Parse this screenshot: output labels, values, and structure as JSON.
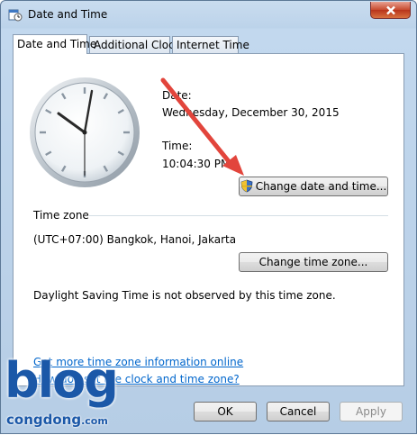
{
  "window": {
    "title": "Date and Time"
  },
  "tabs": [
    {
      "label": "Date and Time",
      "active": true
    },
    {
      "label": "Additional Clocks",
      "active": false
    },
    {
      "label": "Internet Time",
      "active": false
    }
  ],
  "datetime": {
    "date_label": "Date:",
    "date_value": "Wednesday, December 30, 2015",
    "time_label": "Time:",
    "time_value": "10:04:30 PM",
    "change_button": "Change date and time..."
  },
  "timezone": {
    "section_label": "Time zone",
    "value": "(UTC+07:00) Bangkok, Hanoi, Jakarta",
    "change_button": "Change time zone...",
    "dst_note": "Daylight Saving Time is not observed by this time zone."
  },
  "links": {
    "more_info": "Get more time zone information online",
    "how_to": "How do I set the clock and time zone?"
  },
  "buttons": {
    "ok": "OK",
    "cancel": "Cancel",
    "apply": "Apply"
  },
  "watermark": {
    "line1": "blog",
    "line2": "congdong",
    "suffix": ".com"
  },
  "icons": {
    "title": "clock-calendar-icon",
    "close": "close-icon",
    "shield": "uac-shield-icon",
    "clock": "analog-clock-icon",
    "arrow": "red-annotation-arrow"
  },
  "colors": {
    "link": "#0066cc",
    "arrow": "#e2453c",
    "watermark_blue": "#1b58a8"
  }
}
